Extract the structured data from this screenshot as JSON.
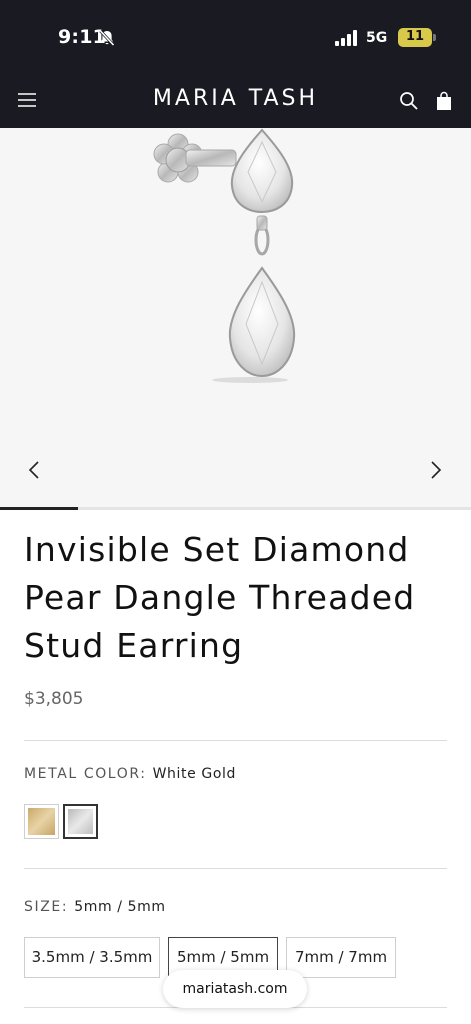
{
  "status_bar": {
    "time": "9:11",
    "network": "5G",
    "battery": "11"
  },
  "header": {
    "brand": "MARIA TASH"
  },
  "gallery": {
    "image_index": 1,
    "image_count": 6,
    "progress": 0.166
  },
  "product": {
    "title": "Invisible Set Diamond Pear Dangle Threaded Stud Earring",
    "price": "$3,805"
  },
  "metal": {
    "label": "METAL COLOR:",
    "value": "White Gold",
    "options": [
      {
        "name": "Yellow Gold",
        "color": "#d8bd86",
        "selected": false
      },
      {
        "name": "White Gold",
        "color": "#d4d4d4",
        "selected": true
      }
    ]
  },
  "size": {
    "label": "SIZE:",
    "value": "5mm / 5mm",
    "options": [
      {
        "label": "3.5mm / 3.5mm",
        "selected": false
      },
      {
        "label": "5mm / 5mm",
        "selected": true
      },
      {
        "label": "7mm / 7mm",
        "selected": false
      }
    ]
  },
  "browser": {
    "url": "mariatash.com"
  },
  "colors": {
    "header_bg": "#1a1b22",
    "gallery_bg": "#f6f6f6",
    "battery": "#d9c94a"
  }
}
